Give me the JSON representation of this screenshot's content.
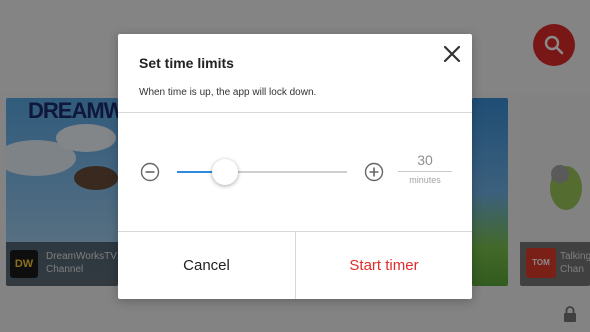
{
  "background": {
    "cards": [
      {
        "brand": "DREAMW",
        "logo": "DW",
        "name": "DreamWorksTV",
        "subtitle": "Channel"
      },
      {
        "logo": "TOM",
        "name": "Talking",
        "subtitle": "Chan"
      }
    ],
    "icons": {
      "search": "search-icon",
      "lock": "lock-icon"
    }
  },
  "dialog": {
    "title": "Set time limits",
    "subtitle": "When time is up, the app will lock down.",
    "minutes_value": "30",
    "minutes_unit": "minutes",
    "slider_level": 0.28,
    "cancel_label": "Cancel",
    "start_label": "Start timer",
    "icons": {
      "close": "close-icon",
      "minus": "minus-circle-icon",
      "plus": "plus-circle-icon"
    }
  },
  "colors": {
    "accent_red": "#e12b2b",
    "slider_blue": "#2d8ae0"
  }
}
